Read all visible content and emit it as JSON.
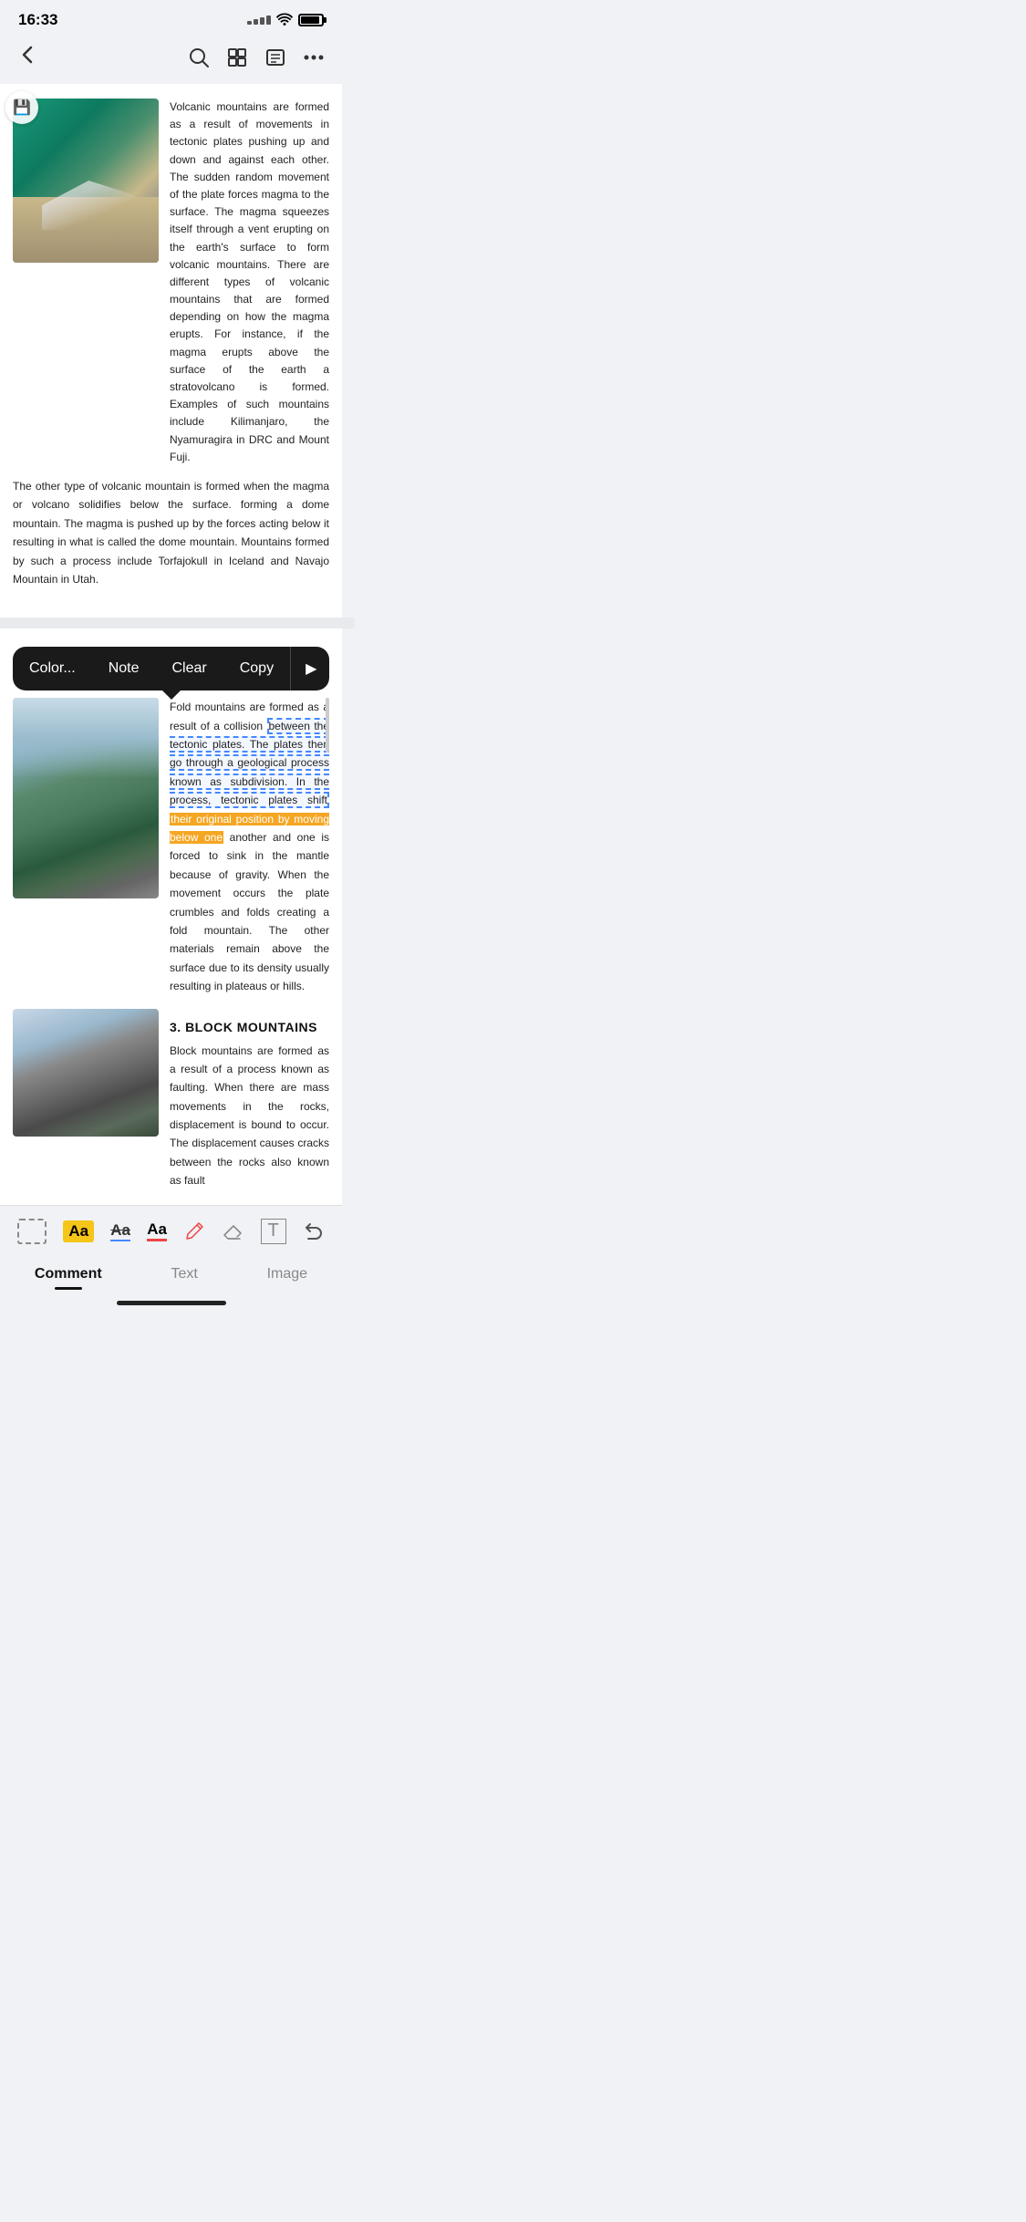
{
  "status": {
    "time": "16:33"
  },
  "nav": {
    "back_icon": "‹",
    "search_icon": "search",
    "grid_icon": "grid",
    "list_icon": "list",
    "more_icon": "more"
  },
  "section1": {
    "text_col": "Volcanic mountains are formed as a result of movements in tectonic plates pushing up and down and against each other. The sudden random movement of the plate forces magma to the surface. The magma squeezes itself through a vent erupting on the earth's surface to form volcanic mountains. There are different types of volcanic mountains that are formed depending on how the magma erupts. For instance, if the magma erupts above the surface of the earth a stratovolcano is formed. Examples of such mountains include Kilimanjaro, the Nyamuragira in DRC and Mount Fuji.",
    "save_icon": "💾"
  },
  "section1_body": "The other type of volcanic mountain is formed when the magma or volcano solidifies below the surface. forming a dome mountain. The magma is pushed up by the forces acting below it resulting in what is called the dome mountain. Mountains formed by such a process include Torfajokull in Iceland and Navajo Mountain in Utah.",
  "tooltip": {
    "color_label": "Color...",
    "note_label": "Note",
    "clear_label": "Clear",
    "copy_label": "Copy",
    "arrow_label": "▶"
  },
  "section_fold": {
    "text": "Fold mountains are formed as a result of a collision between the tectonic plates. The plates then go through a geological process known as subdivision. In the process, tectonic plates shift their original position by moving below one another and one is forced to sink in the mantle because of gravity. When the movement occurs the plate crumbles and folds creating a fold mountain. The other materials remain above the surface due to its density usually resulting in plateaus or hills."
  },
  "section3": {
    "heading": "3. BLOCK MOUNTAINS",
    "text": "Block mountains are formed as a result of a process known as faulting. When there are mass movements in the rocks, displacement is bound to occur. The displacement causes cracks between the rocks also known as fault"
  },
  "toolbar": {
    "selection_title": "selection box",
    "highlight_aa": "Aa",
    "strikethrough_aa": "Aa",
    "underline_aa": "Aa",
    "pen_icon": "✏",
    "eraser_icon": "eraser",
    "text_icon": "T",
    "undo_icon": "↩"
  },
  "tabs": {
    "comment": "Comment",
    "text": "Text",
    "image": "Image",
    "active": "comment"
  }
}
